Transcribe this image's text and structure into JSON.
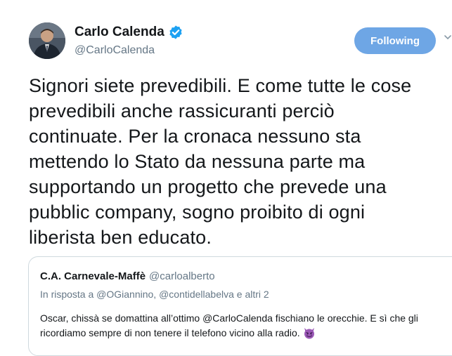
{
  "author": {
    "name": "Carlo Calenda",
    "handle": "@CarloCalenda"
  },
  "follow_button": {
    "label": "Following"
  },
  "tweet": {
    "text": "Signori siete prevedibili. E come tutte le cose\nprevedibili anche rassicuranti perciò\ncontinuate. Per la cronaca nessuno sta\nmettendo lo Stato da nessuna parte ma\nsupportando un progetto che prevede una\npubblic company, sogno proibito di ogni\nliberista ben educato."
  },
  "quoted_tweet": {
    "name": "C.A. Carnevale-Maffè",
    "handle": "@carloalberto",
    "reply_to": "In risposta a @OGiannino, @contidellabelva e altri 2",
    "text": "Oscar, chissà se domattina all’ottimo @CarloCalenda fischiano le orecchie. E sì che gli\nricordiamo sempre di non tenere il telefono vicino alla radio.",
    "emoji": "smiling-devil-emoji"
  },
  "colors": {
    "accent": "#6ea6e5",
    "verified": "#1da1f2",
    "secondary_text": "#657786",
    "emoji_purple": "#9b59b6"
  }
}
